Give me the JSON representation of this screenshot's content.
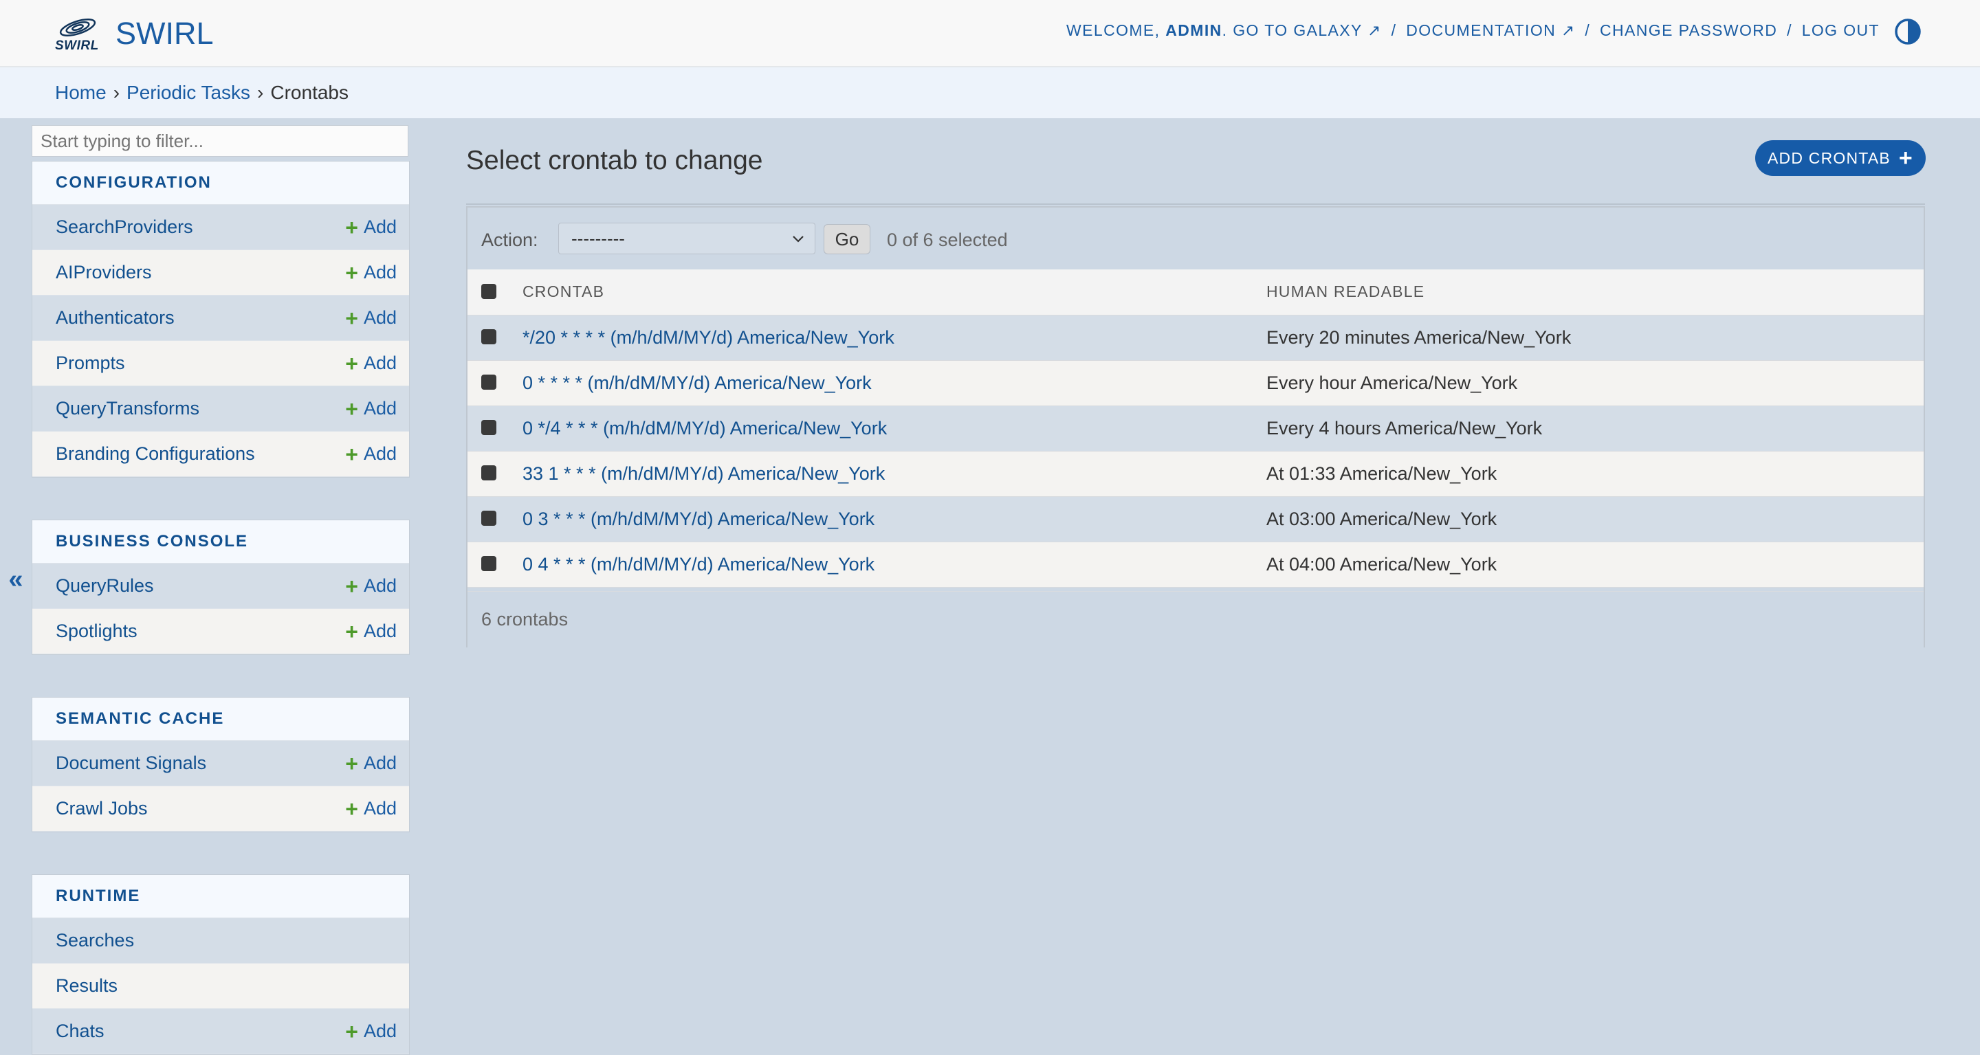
{
  "header": {
    "brand_logo_text": "SWIRL",
    "brand_name": "SWIRL",
    "welcome": "Welcome,",
    "user": "admin",
    "period": ".",
    "links": [
      {
        "label": "Go to Galaxy ↗"
      },
      {
        "label": "Documentation ↗"
      },
      {
        "label": "Change password"
      },
      {
        "label": "Log out"
      }
    ],
    "separator": "/",
    "theme_icon": "half-circle-contrast-icon"
  },
  "breadcrumbs": {
    "home": "Home",
    "app": "Periodic Tasks",
    "current": "Crontabs",
    "separator": "›"
  },
  "sidebar": {
    "filter_placeholder": "Start typing to filter...",
    "collapse_label": "«",
    "add_label": "Add",
    "modules": [
      {
        "caption": "Configuration",
        "items": [
          {
            "label": "SearchProviders",
            "add": true
          },
          {
            "label": "AIProviders",
            "add": true
          },
          {
            "label": "Authenticators",
            "add": true
          },
          {
            "label": "Prompts",
            "add": true
          },
          {
            "label": "QueryTransforms",
            "add": true
          },
          {
            "label": "Branding Configurations",
            "add": true
          }
        ]
      },
      {
        "caption": "Business Console",
        "items": [
          {
            "label": "QueryRules",
            "add": true
          },
          {
            "label": "Spotlights",
            "add": true
          }
        ]
      },
      {
        "caption": "Semantic Cache",
        "items": [
          {
            "label": "Document Signals",
            "add": true
          },
          {
            "label": "Crawl Jobs",
            "add": true
          }
        ]
      },
      {
        "caption": "Runtime",
        "items": [
          {
            "label": "Searches",
            "add": false
          },
          {
            "label": "Results",
            "add": false
          },
          {
            "label": "Chats",
            "add": true
          }
        ]
      }
    ]
  },
  "content": {
    "title": "Select crontab to change",
    "add_button": "Add crontab",
    "action_label": "Action:",
    "action_selected": "---------",
    "go_label": "Go",
    "selected_count": "0 of 6 selected",
    "columns": [
      "Crontab",
      "Human readable"
    ],
    "rows": [
      {
        "crontab": "*/20 * * * * (m/h/dM/MY/d) America/New_York",
        "human": "Every 20 minutes America/New_York"
      },
      {
        "crontab": "0 * * * * (m/h/dM/MY/d) America/New_York",
        "human": "Every hour America/New_York"
      },
      {
        "crontab": "0 */4 * * * (m/h/dM/MY/d) America/New_York",
        "human": "Every 4 hours America/New_York"
      },
      {
        "crontab": "33 1 * * * (m/h/dM/MY/d) America/New_York",
        "human": "At 01:33 America/New_York"
      },
      {
        "crontab": "0 3 * * * (m/h/dM/MY/d) America/New_York",
        "human": "At 03:00 America/New_York"
      },
      {
        "crontab": "0 4 * * * (m/h/dM/MY/d) America/New_York",
        "human": "At 04:00 America/New_York"
      }
    ],
    "paginator": "6 crontabs"
  },
  "colors": {
    "primary": "#1a5ca3",
    "add_green": "#4d9a2a",
    "page_bg": "#cdd8e4",
    "header_bg": "#f8f8f8"
  }
}
